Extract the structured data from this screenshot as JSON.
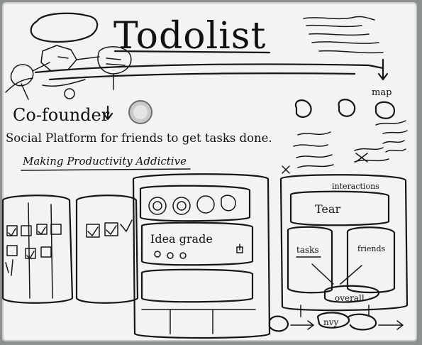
{
  "title": "Todolist",
  "cofounder_label": "Co-founder",
  "tagline": "Social Platform for friends to get tasks done.",
  "subtitle": "Making Productivity Addictive",
  "map_label": "map",
  "phone_card_text": "Idea grade",
  "right_panel": {
    "header": "interactions",
    "card_label": "Tear",
    "tasks_label": "tasks",
    "friends_label": "friends",
    "overall_label": "overall"
  },
  "bottom_node_label": "nvy",
  "colors": {
    "board": "#f3f4f2",
    "ink": "#161616",
    "frame": "#9a9c9c",
    "magnet": "#c9c9c9"
  }
}
